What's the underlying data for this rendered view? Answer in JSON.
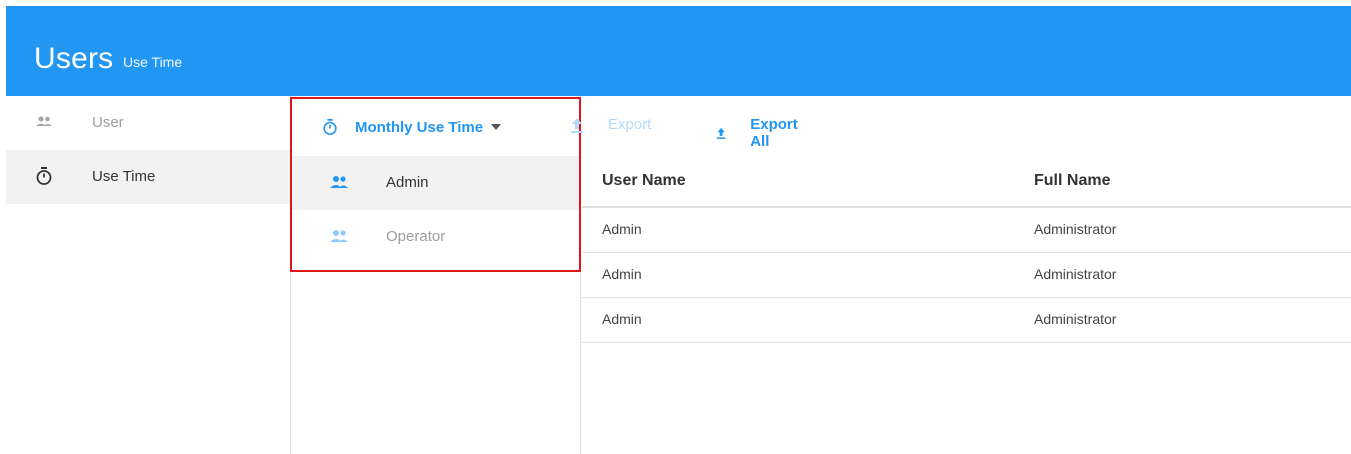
{
  "header": {
    "title": "Users",
    "subtitle": "Use Time"
  },
  "sidebar": {
    "items": [
      {
        "label": "User",
        "icon": "users-icon",
        "active": false
      },
      {
        "label": "Use Time",
        "icon": "stopwatch-icon",
        "active": true
      }
    ]
  },
  "toolbar": {
    "period_dropdown": {
      "label": "Monthly Use Time",
      "icon": "stopwatch-icon"
    },
    "export_label": "Export",
    "export_all_label": "Export All"
  },
  "groups": [
    {
      "label": "Admin",
      "icon": "users-icon",
      "active": true
    },
    {
      "label": "Operator",
      "icon": "users-icon",
      "active": false
    }
  ],
  "table": {
    "columns": [
      "User Name",
      "Full Name"
    ],
    "rows": [
      [
        "Admin",
        "Administrator"
      ],
      [
        "Admin",
        "Administrator"
      ],
      [
        "Admin",
        "Administrator"
      ]
    ]
  },
  "colors": {
    "accent": "#2196f3",
    "highlight_border": "#e01616",
    "active_row_bg": "#f2f2f2"
  }
}
